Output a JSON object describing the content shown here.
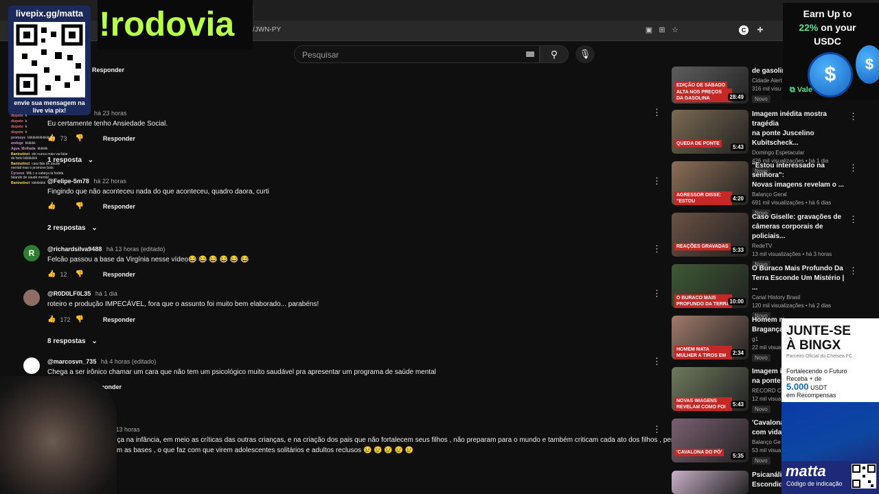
{
  "browser": {
    "url": "/JWN-PY"
  },
  "youtube": {
    "search_placeholder": "Pesquisar"
  },
  "comments": [
    {
      "reply": "Responder"
    },
    {
      "time": "há 23 horas",
      "text": "Eu certamente tenho Ansiedade Social.",
      "likes": "73",
      "reply": "Responder",
      "replies_toggle": "1 resposta"
    },
    {
      "author": "@Felipe-5m78",
      "time": "há 22 horas",
      "text": "Fingindo que não aconteceu nada do que aconteceu, quadro daora, curti",
      "reply": "Responder",
      "replies_toggle": "2 respostas"
    },
    {
      "avatar_letter": "R",
      "author": "@richardsilva9488",
      "time": "há 13 horas (editado)",
      "text": "Felcão passou a base da Virgínia nesse vídeo😂 😂 😂 😂 😂 😂",
      "likes": "12",
      "reply": "Responder"
    },
    {
      "author": "@R0D0LF0L35",
      "time": "há 1 dia",
      "text": "roteiro e produção IMPECÁVEL, fora que o assunto foi muito bem elaborado... parabéns!",
      "likes": "172",
      "reply": "Responder",
      "replies_toggle": "8 respostas"
    },
    {
      "author": "@marcosvn_735",
      "time": "há 4 horas (editado)",
      "text": "Chega a ser irônico chamar um cara que não tem um psicológico muito saudável pra apresentar um programa de saúde mental",
      "reply": "Responder"
    },
    {
      "author": "ch",
      "time": "há 13 horas",
      "text_line1": "começa na infância,  em meio as críticas das outras crianças,  e na criação dos pais que não fortalecem seus filhos , não preparam para o mundo e também criticam cada ato dos filhos , pensando",
      "text_line2": "tiram as bases , o que faz com que virem adolescentes  solitários e adultos reclusos 😢 😢 😢 😢 😢"
    }
  ],
  "sidebar_videos": [
    {
      "title_line1": "de gasolin",
      "channel": "Cidade Alert",
      "stats": "316 mil visu",
      "badge": "Novo",
      "duration": "28:49",
      "thumb_caption_1": "EDIÇÃO DE SÁBADO",
      "thumb_caption_2": "ALTA NOS PREÇOS DA GASOLINA",
      "thumb_color": "#5e5e5e"
    },
    {
      "title_line1": "Imagem inédita mostra tragédia",
      "title_line2": "na ponte Juscelino Kubitscheck...",
      "channel": "Domingo Espetacular",
      "stats": "426 mil visualizações • há 1 dia",
      "badge": "Novo",
      "duration": "5:43",
      "thumb_caption": "QUEDA DE PONTE",
      "thumb_color": "#7a6a52"
    },
    {
      "title_line1": "\"Estou interessado na senhora\":",
      "title_line2": "Novas imagens revelam o ...",
      "channel": "Balanço Geral",
      "stats": "691 mil visualizações • há 6 dias",
      "badge": "Novo",
      "duration": "4:20",
      "thumb_caption": "AGRESSOR DISSE: \"ESTOU INTERESSADO NA SENHORA\"",
      "thumb_color": "#8c6e56"
    },
    {
      "title_line1": "Caso Giselle: gravações de",
      "title_line2": "câmeras corporais de policiais...",
      "channel": "RedeTV",
      "stats": "13 mil visualizações • há 3 horas",
      "badge": "Novo",
      "duration": "5:33",
      "thumb_caption": "REAÇÕES GRAVADAS",
      "thumb_color": "#6b5244"
    },
    {
      "title_line1": "O Buraco Mais Profundo Da",
      "title_line2": "Terra Esconde Um Mistério | ...",
      "channel": "Canal History Brasil",
      "stats": "120 mil visualizações • há 2 dias",
      "badge": "Novo",
      "duration": "10:00",
      "thumb_caption": "O BURACO MAIS PROFUNDO DA TERRA",
      "thumb_color": "#3d5a34"
    },
    {
      "title_line1": "Homem m",
      "title_line2": "Bragança",
      "channel": "g1",
      "stats": "22 mil visua",
      "badge": "Novo",
      "duration": "2:34",
      "thumb_caption": "HOMEM MATA MULHER A TIROS EM BRAGANÇA PAULISTA, INTERIOR",
      "thumb_color": "#a07a6a"
    },
    {
      "title_line1": "Imagem i",
      "title_line2": "na ponte",
      "channel": "RECORD CA",
      "stats": "12 mil visua",
      "badge": "Novo",
      "duration": "5:43",
      "thumb_caption": "NOVAS IMAGENS REVELAM COMO FOI A QUEDA DE PONTE",
      "thumb_color": "#6e7a5c"
    },
    {
      "title_line1": "'Cavalona",
      "title_line2": "com vida",
      "channel": "Balanço Ge",
      "stats": "53 mil visua",
      "badge": "Novo",
      "duration": "5:35",
      "thumb_caption": "'CAVALONA DO PÓ'",
      "thumb_color": "#7a6070"
    },
    {
      "title_line1": "Psicanális",
      "title_line2": "Escondida",
      "thumb_color": "#c9b0c8"
    }
  ],
  "overlays": {
    "livepix_url": "livepix.gg/matta",
    "livepix_sub": "envie sua mensagem na live via pix!",
    "command": "!rodovia",
    "usdc": {
      "line1": "Earn Up to",
      "rate": "22%",
      "line2": "on your",
      "line3": "USDC",
      "vale": "Vale"
    },
    "bingx": {
      "title1": "JUNTE-SE",
      "title2": "À BINGX",
      "sub": "Parceiro Oficial do Chelsea FC",
      "body1": "Fortalecendo o Futuro",
      "body2": "Receba + de",
      "amount": "5.000",
      "currency": "USDT",
      "body3": "em Recompensas",
      "brand": "matta",
      "code_label": "Código de indicação"
    }
  },
  "chat": [
    {
      "user": "dizpoto",
      "msg": "k"
    },
    {
      "user": "dizpoto",
      "msg": "k"
    },
    {
      "user": "dizpoto",
      "msg": "k"
    },
    {
      "user": "dizpoto",
      "msg": "k"
    },
    {
      "user": "promoye",
      "msg": "kkkkkkkkkkkkkkkk"
    },
    {
      "user": "andoge",
      "msg": "kkkkkk"
    },
    {
      "user": "Agua_Molhada",
      "msg": "kkkkkk"
    },
    {
      "user": "Baninstinct",
      "msg": "ele nunca mais vai falar de beto kkkkkkkk"
    },
    {
      "user": "Baninstinct",
      "msg": "cara fala de saude mental mas o promove bots"
    },
    {
      "user": "Cyrseve",
      "msg": "Mik c a cabeça ta fodida falando de saude mental"
    },
    {
      "user": "Baninstinct",
      "msg": "kkkkkkkk"
    }
  ],
  "colors": {
    "usdc_rate": "#52e08a",
    "command": "#b8ff4a",
    "bingx_accent": "#1565c0"
  }
}
